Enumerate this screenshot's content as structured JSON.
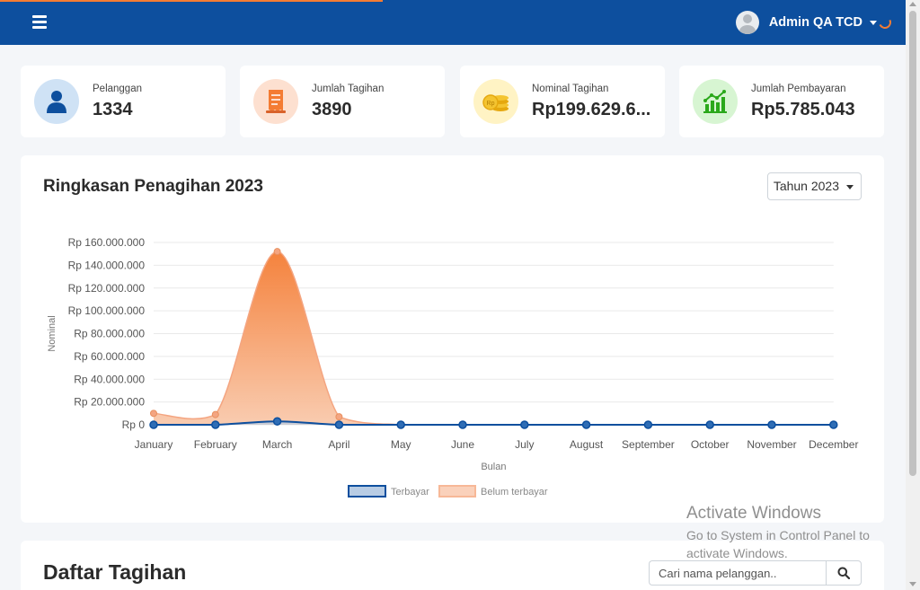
{
  "header": {
    "user_name": "Admin QA TCD",
    "colors": {
      "bar": "#0d4f9e",
      "loading": "#f47c33"
    }
  },
  "stats": [
    {
      "label": "Pelanggan",
      "value": "1334",
      "icon": "user-icon"
    },
    {
      "label": "Jumlah Tagihan",
      "value": "3890",
      "icon": "receipt-icon"
    },
    {
      "label": "Nominal Tagihan",
      "value": "Rp199.629.6...",
      "icon": "coins-icon"
    },
    {
      "label": "Jumlah Pembayaran",
      "value": "Rp5.785.043",
      "icon": "growth-chart-icon"
    }
  ],
  "summary": {
    "title": "Ringkasan Penagihan 2023",
    "year_select": "Tahun 2023"
  },
  "chart_data": {
    "type": "area",
    "x": [
      "January",
      "February",
      "March",
      "April",
      "May",
      "June",
      "July",
      "August",
      "September",
      "October",
      "November",
      "December"
    ],
    "xlabel": "Bulan",
    "ylabel": "Nominal",
    "ylim": [
      0,
      160000000
    ],
    "yticks": [
      "Rp 0",
      "Rp 20.000.000",
      "Rp 40.000.000",
      "Rp 60.000.000",
      "Rp 80.000.000",
      "Rp 100.000.000",
      "Rp 120.000.000",
      "Rp 140.000.000",
      "Rp 160.000.000"
    ],
    "grid": true,
    "legend_position": "bottom",
    "series": [
      {
        "name": "Terbayar",
        "color": "#0d4f9e",
        "fill": "#b8cce4",
        "values": [
          0,
          0,
          3000000,
          0,
          0,
          0,
          0,
          0,
          0,
          0,
          0,
          0
        ]
      },
      {
        "name": "Belum terbayar",
        "color": "#f4a581",
        "fill": "#f47c33",
        "values": [
          10000000,
          9000000,
          152000000,
          7000000,
          0,
          0,
          0,
          0,
          0,
          0,
          0,
          0
        ]
      }
    ]
  },
  "list": {
    "title": "Daftar Tagihan",
    "search_placeholder": "Cari nama pelanggan.."
  },
  "watermark": {
    "title": "Activate Windows",
    "line1": "Go to System in Control Panel to",
    "line2": "activate Windows."
  }
}
